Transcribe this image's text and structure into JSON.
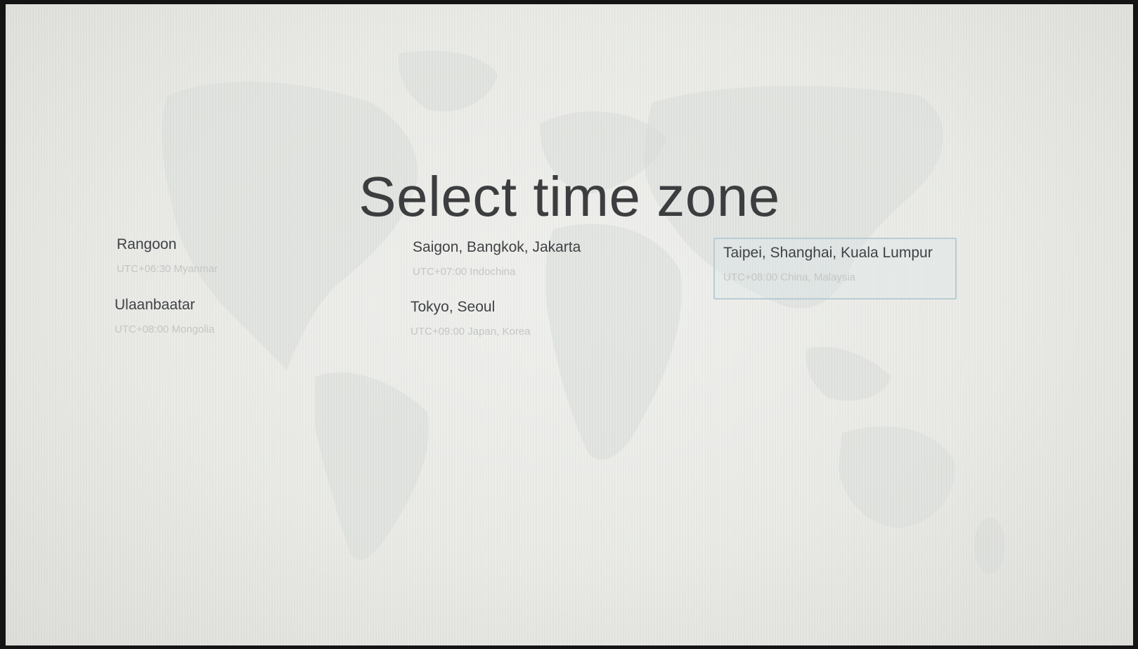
{
  "title": "Select time zone",
  "timezones": [
    {
      "city": "Rangoon",
      "detail": "UTC+06:30 Myanmar",
      "selected": false
    },
    {
      "city": "Ulaanbaatar",
      "detail": "UTC+08:00 Mongolia",
      "selected": false
    },
    {
      "city": "Saigon, Bangkok, Jakarta",
      "detail": "UTC+07:00 Indochina",
      "selected": false
    },
    {
      "city": "Tokyo, Seoul",
      "detail": "UTC+09:00 Japan, Korea",
      "selected": false
    },
    {
      "city": "Taipei, Shanghai, Kuala Lumpur",
      "detail": "UTC+08:00 China, Malaysia",
      "selected": true
    }
  ],
  "colors": {
    "background": "#e9eae6",
    "title": "#3c3d3f",
    "city": "#3f4145",
    "detail": "#c4c6c4",
    "selection_border": "#b9ccd2"
  }
}
